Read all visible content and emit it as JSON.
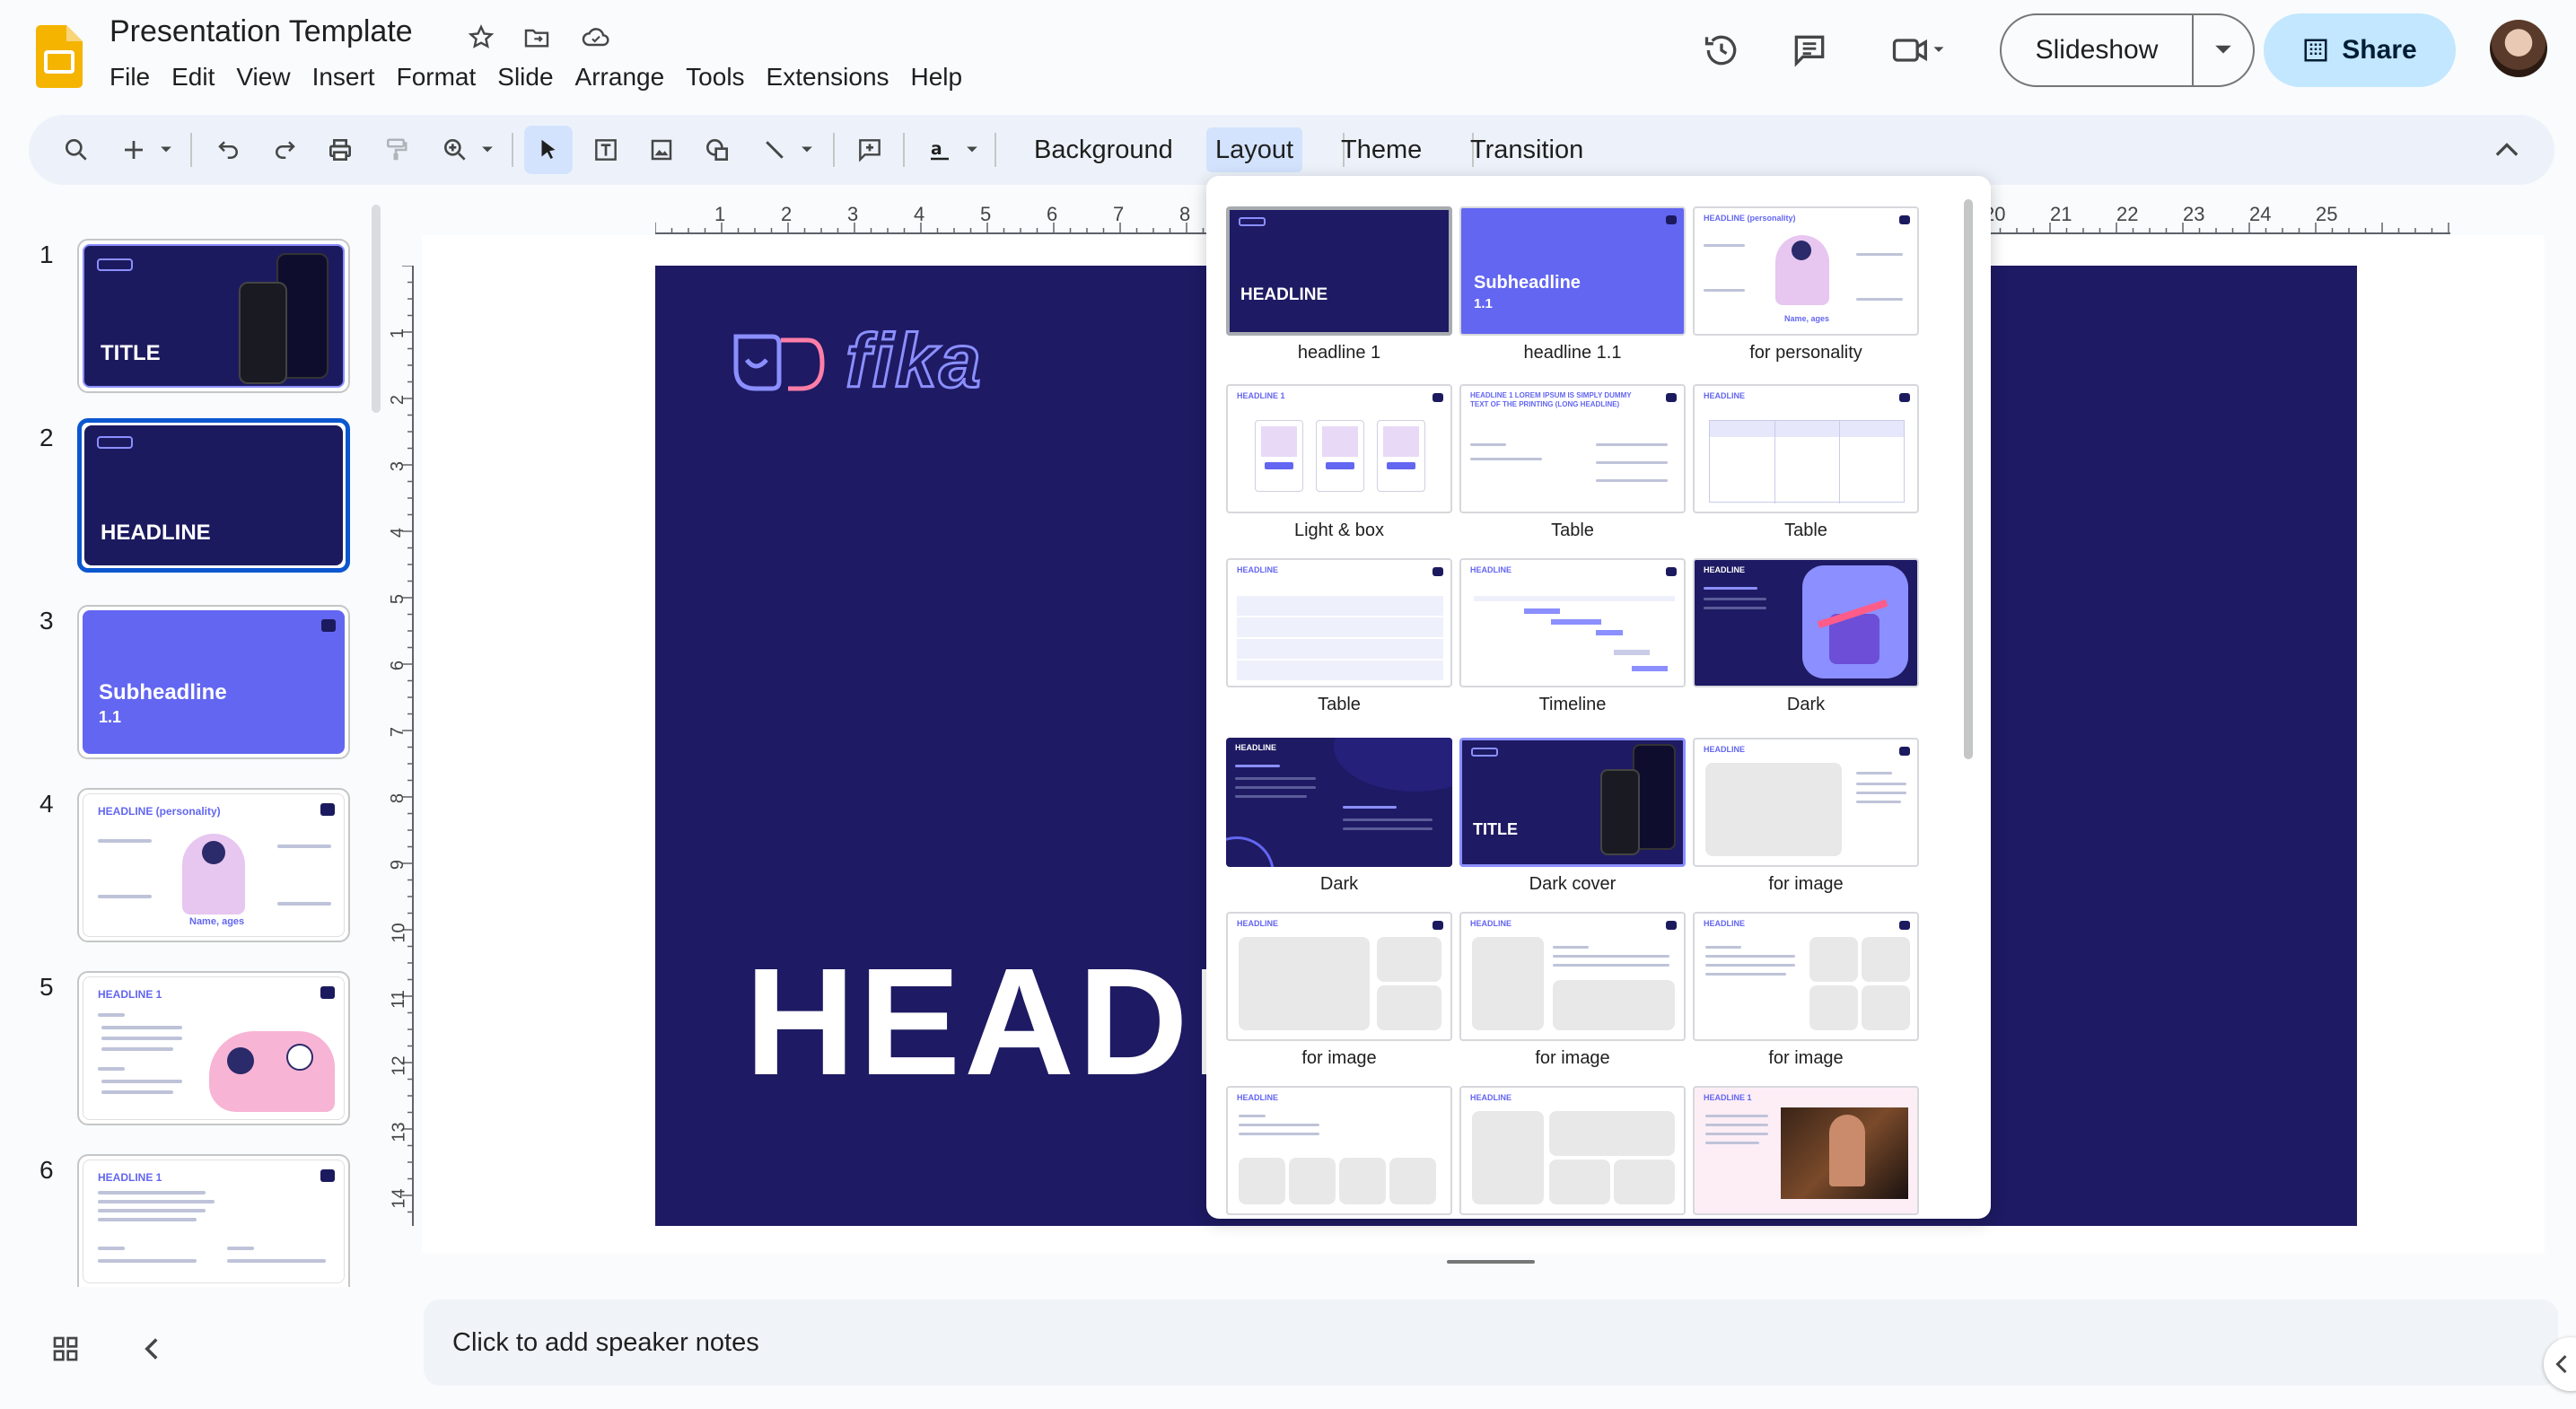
{
  "app": {
    "document_title": "Presentation Template",
    "icon": "google-slides-icon",
    "menu": [
      "File",
      "Edit",
      "View",
      "Insert",
      "Format",
      "Slide",
      "Arrange",
      "Tools",
      "Extensions",
      "Help"
    ]
  },
  "header": {
    "slideshow_label": "Slideshow",
    "share_label": "Share",
    "icons": [
      "star-icon",
      "move-to-folder-icon",
      "cloud-saved-icon",
      "version-history-icon",
      "comments-icon",
      "meet-camera-icon",
      "avatar"
    ]
  },
  "toolbar": {
    "items": [
      "Background",
      "Layout",
      "Theme",
      "Transition"
    ],
    "active": "Layout"
  },
  "filmstrip": {
    "slides": [
      {
        "number": "1",
        "title": "TITLE",
        "style": "dark-cover"
      },
      {
        "number": "2",
        "title": "HEADLINE",
        "style": "dark"
      },
      {
        "number": "3",
        "title": "Subheadline",
        "subtitle": "1.1",
        "style": "violet"
      },
      {
        "number": "4",
        "title": "HEADLINE (personality)",
        "caption": "Name, ages",
        "style": "white"
      },
      {
        "number": "5",
        "title": "HEADLINE 1",
        "style": "white"
      },
      {
        "number": "6",
        "title": "HEADLINE 1",
        "style": "white"
      }
    ],
    "selected": "2"
  },
  "slide": {
    "logo_text": "fika",
    "headline": "HEADL"
  },
  "layout_panel": {
    "layouts": [
      {
        "label": "headline 1",
        "thumb_text": "HEADLINE"
      },
      {
        "label": "headline 1.1",
        "thumb_text": "Subheadline",
        "thumb_sub": "1.1"
      },
      {
        "label": "for personality",
        "thumb_text": "HEADLINE (personality)",
        "thumb_caption": "Name, ages"
      },
      {
        "label": "Light & box",
        "thumb_text": "HEADLINE 1"
      },
      {
        "label": "Table",
        "thumb_text": "HEADLINE 1 LOREM IPSUM IS SIMPLY DUMMY TEXT OF THE PRINTING (LONG HEADLINE)"
      },
      {
        "label": "Table",
        "thumb_text": "HEADLINE"
      },
      {
        "label": "Table",
        "thumb_text": "HEADLINE"
      },
      {
        "label": "Timeline",
        "thumb_text": "HEADLINE"
      },
      {
        "label": "Dark",
        "thumb_text": "HEADLINE"
      },
      {
        "label": "Dark",
        "thumb_text": "HEADLINE"
      },
      {
        "label": "Dark cover",
        "thumb_text": "TITLE"
      },
      {
        "label": "for image",
        "thumb_text": "HEADLINE"
      },
      {
        "label": "for image",
        "thumb_text": "HEADLINE"
      },
      {
        "label": "for image",
        "thumb_text": "HEADLINE"
      },
      {
        "label": "for image",
        "thumb_text": "HEADLINE"
      },
      {
        "label": "",
        "thumb_text": "HEADLINE"
      },
      {
        "label": "",
        "thumb_text": "HEADLINE"
      },
      {
        "label": "",
        "thumb_text": "HEADLINE 1"
      }
    ]
  },
  "rulers": {
    "horizontal": [
      "1",
      "2",
      "3",
      "4",
      "5",
      "6",
      "7",
      "8",
      "20",
      "21",
      "22",
      "23",
      "24",
      "25"
    ],
    "vertical": [
      "1",
      "2",
      "3",
      "4",
      "5",
      "6",
      "7",
      "8",
      "9",
      "10",
      "11",
      "12",
      "13",
      "14"
    ]
  },
  "notes": {
    "placeholder": "Click to add speaker notes"
  },
  "colors": {
    "slide_bg": "#1e1a63",
    "accent": "#6366f1",
    "share_bg": "#c2e7ff",
    "selection": "#0b57d0"
  }
}
